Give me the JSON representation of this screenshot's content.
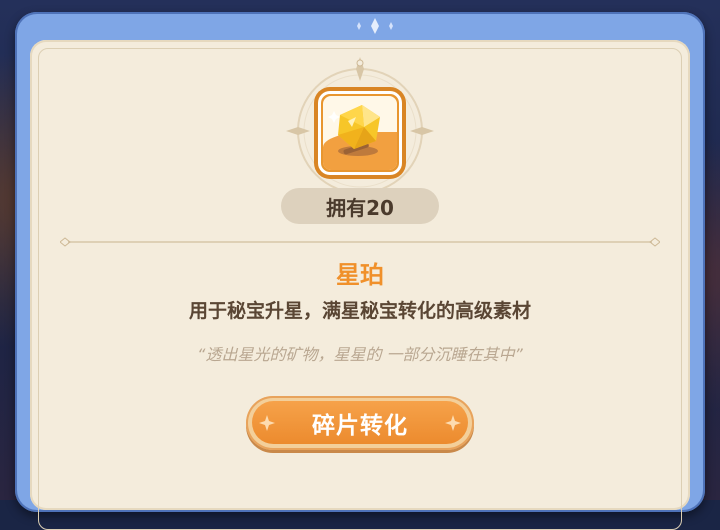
{
  "item": {
    "name": "星珀",
    "owned_label": "拥有20",
    "description": "用于秘宝升星，满星秘宝转化的高级素材",
    "flavor_text": "“透出星光的矿物，星星的 一部分沉睡在其中”",
    "icon": "amber-star-gem-icon"
  },
  "actions": {
    "convert_label": "碎片转化"
  },
  "colors": {
    "frame": "#7fa6e6",
    "panel": "#f4ecdc",
    "accent": "#f0902a",
    "button": "#ec8b2e"
  }
}
